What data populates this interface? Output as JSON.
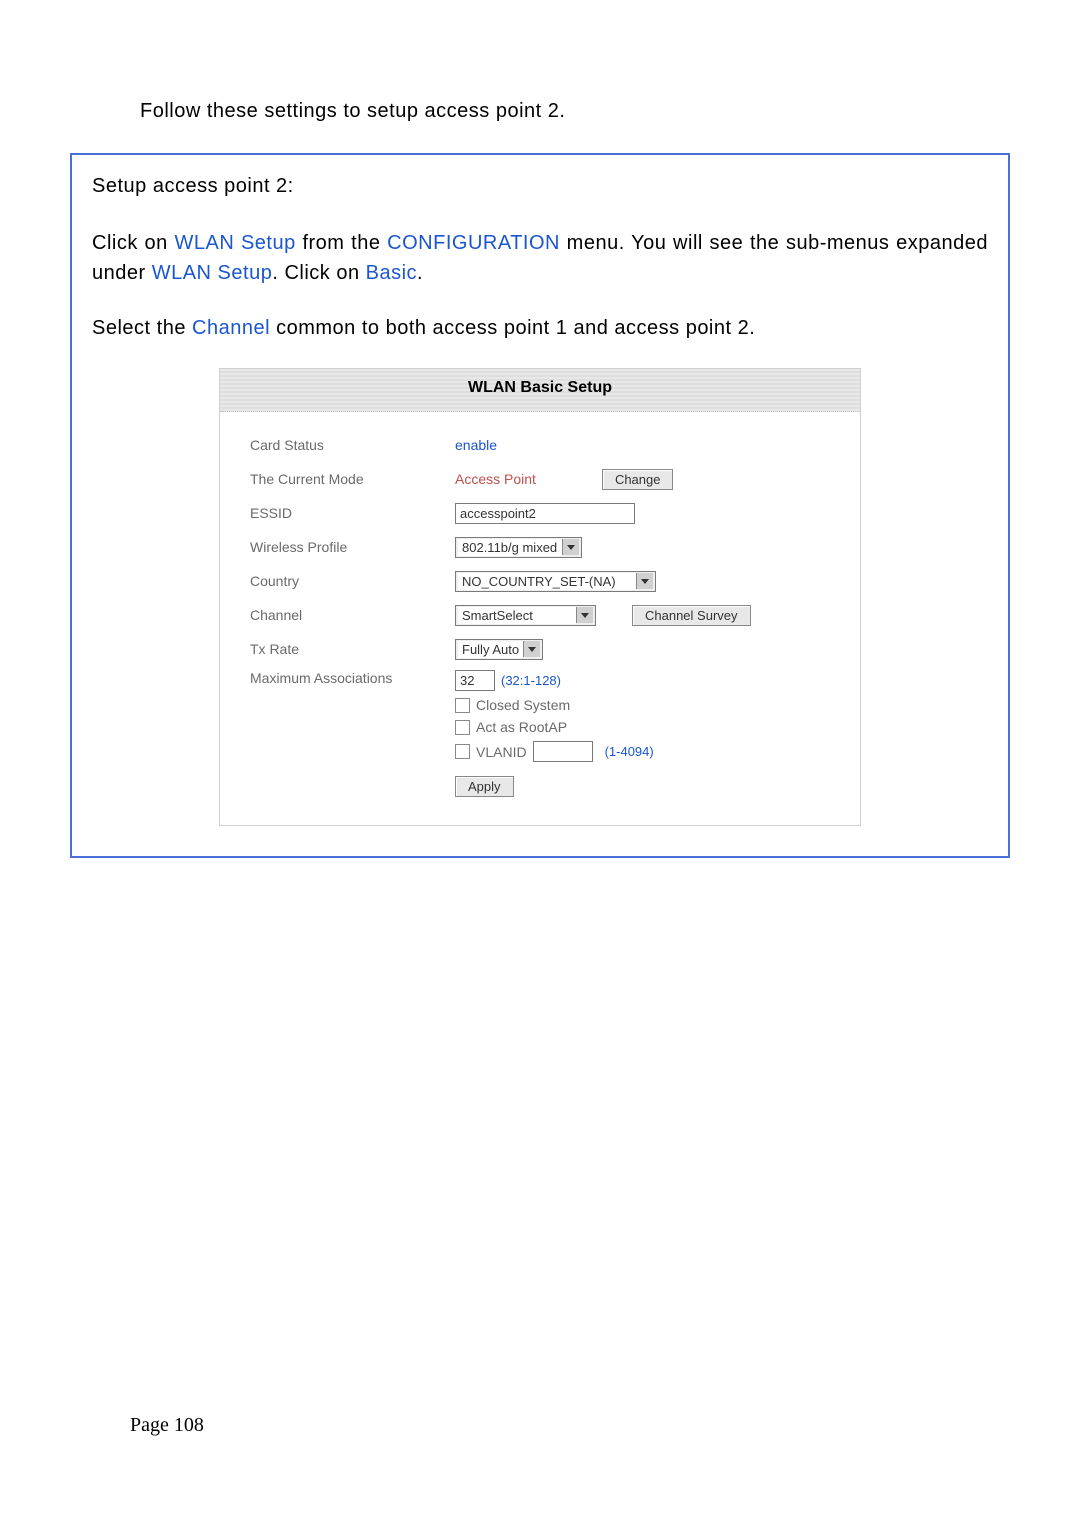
{
  "intro": "Follow these settings to setup access point 2.",
  "setup_header": "Setup access point 2:",
  "instruction1_pre": "Click on ",
  "wlan_setup": "WLAN Setup",
  "instruction1_mid1": " from the ",
  "configuration": "CONFIGURATION",
  "instruction1_mid2": " menu. You will see the sub-menus expanded under ",
  "instruction1_mid3": ". Click on ",
  "basic": "Basic",
  "period": ".",
  "instruction2_pre": "Select the ",
  "channel_word": "Channel",
  "instruction2_post": " common to both access point 1 and access point 2.",
  "form": {
    "title": "WLAN Basic Setup",
    "card_status_label": "Card Status",
    "card_status_value": "enable",
    "current_mode_label": "The Current Mode",
    "current_mode_value": "Access Point",
    "change_btn": "Change",
    "essid_label": "ESSID",
    "essid_value": "accesspoint2",
    "wireless_profile_label": "Wireless Profile",
    "wireless_profile_value": "802.11b/g mixed",
    "country_label": "Country",
    "country_value": "NO_COUNTRY_SET-(NA)",
    "channel_label": "Channel",
    "channel_value": "SmartSelect",
    "channel_survey_btn": "Channel Survey",
    "txrate_label": "Tx Rate",
    "txrate_value": "Fully Auto",
    "max_assoc_label": "Maximum Associations",
    "max_assoc_value": "32",
    "max_assoc_hint": "(32:1-128)",
    "closed_system": "Closed System",
    "act_rootap": "Act as RootAP",
    "vlanid": "VLANID",
    "vlanid_hint": "(1-4094)",
    "apply_btn": "Apply"
  },
  "page_number": "Page 108"
}
